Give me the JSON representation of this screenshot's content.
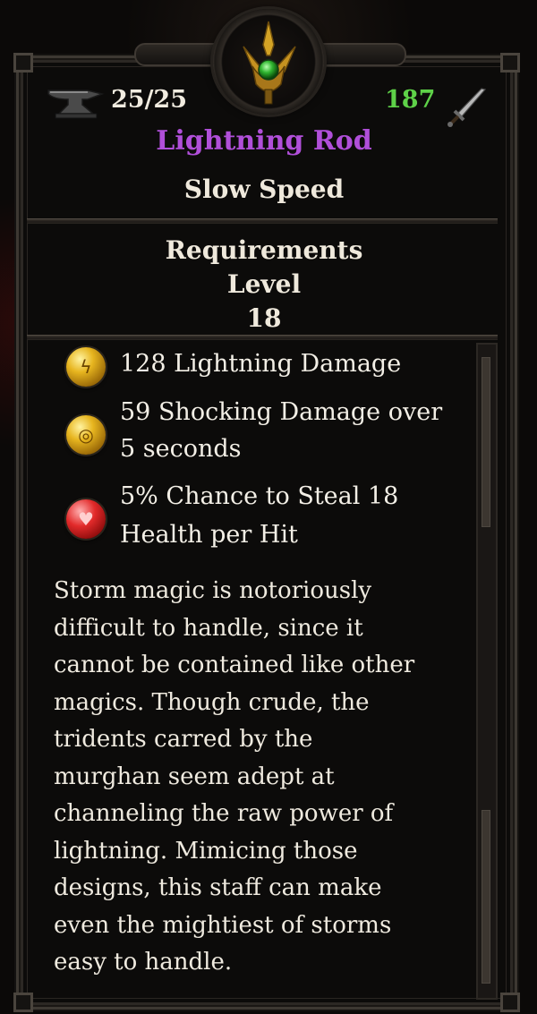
{
  "tooltip": {
    "durability": "25/25",
    "power": "187",
    "item_name": "Lightning Rod",
    "speed": "Slow Speed",
    "requirements": {
      "title": "Requirements",
      "level_label": "Level",
      "level_value": "18"
    },
    "stats": [
      {
        "icon": "lightning-orb-icon",
        "lines": [
          "128 Lightning Damage"
        ]
      },
      {
        "icon": "shock-orb-icon",
        "lines": [
          "59 Shocking Damage over",
          "5 seconds"
        ]
      },
      {
        "icon": "health-orb-icon",
        "lines": [
          "5% Chance to Steal 18",
          "Health per Hit"
        ]
      }
    ],
    "lore": [
      "Storm magic is notoriously",
      "difficult to handle, since it",
      "cannot be contained like other",
      "magics. Though crude, the",
      "tridents carred by the",
      "murghan seem adept at",
      "channeling the raw power of",
      "lightning. Mimicing those",
      "designs, this staff can make",
      "even the mightiest of storms",
      "easy to handle."
    ]
  },
  "colors": {
    "item_name": "#b04fd9",
    "power": "#5ed148",
    "text": "#efe9dc"
  }
}
